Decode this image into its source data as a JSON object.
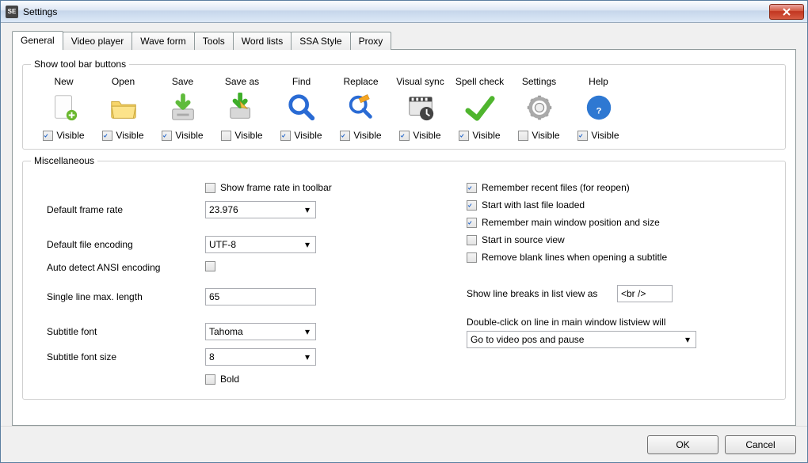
{
  "window": {
    "title": "Settings",
    "app_icon": "SE"
  },
  "tabs": [
    {
      "label": "General",
      "active": true
    },
    {
      "label": "Video player",
      "active": false
    },
    {
      "label": "Wave form",
      "active": false
    },
    {
      "label": "Tools",
      "active": false
    },
    {
      "label": "Word lists",
      "active": false
    },
    {
      "label": "SSA Style",
      "active": false
    },
    {
      "label": "Proxy",
      "active": false
    }
  ],
  "toolbar_group": {
    "title": "Show tool bar buttons",
    "visible_word": "Visible",
    "items": [
      {
        "label": "New",
        "icon": "new-doc-icon",
        "visible": true
      },
      {
        "label": "Open",
        "icon": "folder-icon",
        "visible": true
      },
      {
        "label": "Save",
        "icon": "save-icon",
        "visible": true
      },
      {
        "label": "Save as",
        "icon": "save-as-icon",
        "visible": false
      },
      {
        "label": "Find",
        "icon": "find-icon",
        "visible": true
      },
      {
        "label": "Replace",
        "icon": "replace-icon",
        "visible": true
      },
      {
        "label": "Visual sync",
        "icon": "visual-sync-icon",
        "visible": true
      },
      {
        "label": "Spell check",
        "icon": "spell-check-icon",
        "visible": true
      },
      {
        "label": "Settings",
        "icon": "settings-icon",
        "visible": false
      },
      {
        "label": "Help",
        "icon": "help-icon",
        "visible": true
      }
    ]
  },
  "misc": {
    "title": "Miscellaneous",
    "show_frame_rate_label": "Show frame rate in toolbar",
    "show_frame_rate": false,
    "default_frame_rate_label": "Default frame rate",
    "default_frame_rate": "23.976",
    "default_encoding_label": "Default file encoding",
    "default_encoding": "UTF-8",
    "auto_detect_label": "Auto detect ANSI encoding",
    "auto_detect": false,
    "single_line_max_label": "Single line max. length",
    "single_line_max": "65",
    "subtitle_font_label": "Subtitle font",
    "subtitle_font": "Tahoma",
    "subtitle_font_size_label": "Subtitle font size",
    "subtitle_font_size": "8",
    "bold_label": "Bold",
    "bold": false,
    "remember_recent_label": "Remember recent files (for reopen)",
    "remember_recent": true,
    "start_last_label": "Start with last file loaded",
    "start_last": true,
    "remember_window_label": "Remember main window position and size",
    "remember_window": true,
    "start_source_label": "Start in source view",
    "start_source": false,
    "remove_blank_label": "Remove blank lines when opening a subtitle",
    "remove_blank": false,
    "line_breaks_label": "Show line breaks in list view as",
    "line_breaks_value": "<br />",
    "dbl_click_label": "Double-click on line in main window listview will",
    "dbl_click_value": "Go to video pos and pause"
  },
  "footer": {
    "ok": "OK",
    "cancel": "Cancel"
  }
}
